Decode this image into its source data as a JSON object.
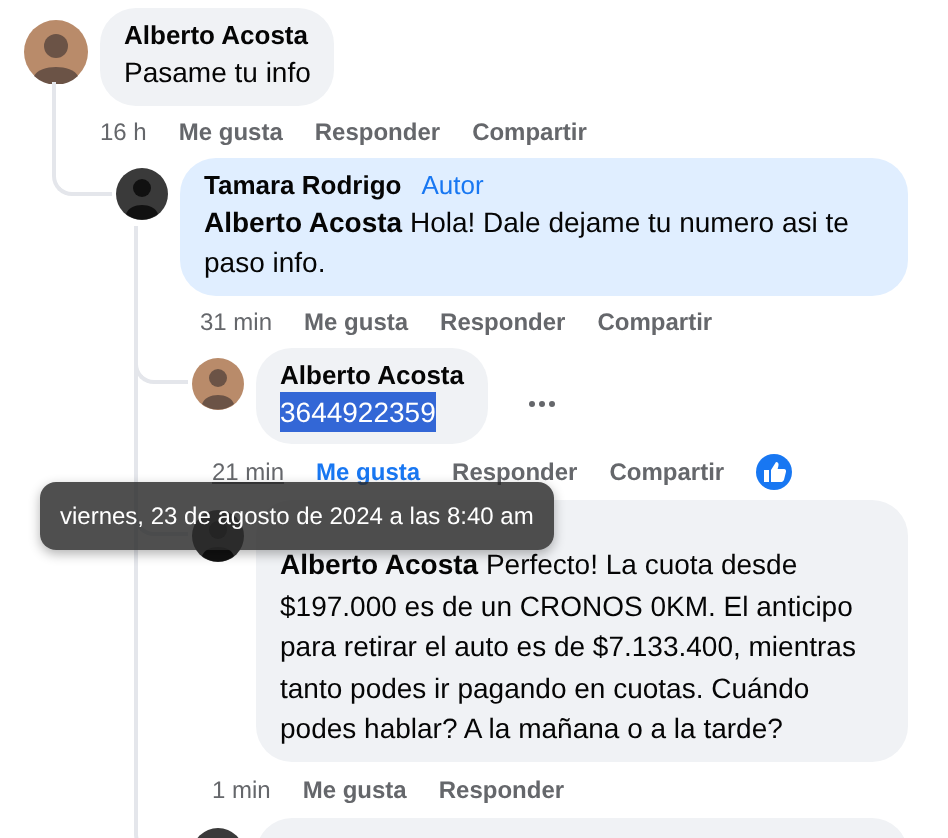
{
  "comments": [
    {
      "author": "Alberto Acosta",
      "text": "Pasame tu info",
      "time": "16 h",
      "actions": [
        "Me gusta",
        "Responder",
        "Compartir"
      ],
      "liked": false,
      "replies": [
        {
          "author": "Tamara Rodrigo",
          "badge": "Autor",
          "highlighted": true,
          "text": "**Alberto Acosta** Hola! Dale dejame tu numero asi te paso info.",
          "time": "31 min",
          "actions": [
            "Me gusta",
            "Responder",
            "Compartir"
          ],
          "liked": false,
          "replies": [
            {
              "kind": "comment",
              "author": "Alberto Acosta",
              "text": "3644922359",
              "selected": true,
              "time": "21 min",
              "time_tooltip": "viernes, 23 de agosto de 2024 a las 8:40 am",
              "actions": [
                "Me gusta",
                "Responder",
                "Compartir"
              ],
              "liked": true
            },
            {
              "kind": "comment",
              "text": "**Alberto Acosta** Perfecto! La cuota desde $197.000 es de un CRONOS 0KM. El anticipo para retirar el auto es de $7.133.400, mientras tanto podes ir pagando en cuotas. Cuándo podes hablar? A la mañana o a la tarde?",
              "selected": false,
              "time": "1 min",
              "actions": [
                "Me gusta",
                "Responder"
              ],
              "liked": false
            },
            {
              "kind": "cut_off"
            }
          ]
        }
      ]
    }
  ]
}
